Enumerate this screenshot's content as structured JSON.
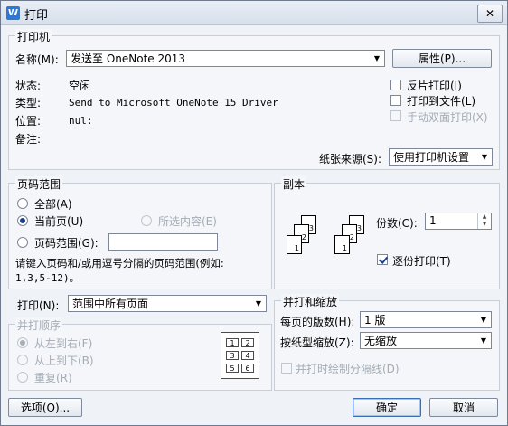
{
  "window": {
    "title": "打印",
    "app_icon": "W",
    "close_glyph": "✕"
  },
  "printer": {
    "group_label": "打印机",
    "name_label": "名称(M):",
    "name_value": "发送至 OneNote 2013",
    "properties_button": "属性(P)...",
    "status_label": "状态:",
    "status_value": "空闲",
    "type_label": "类型:",
    "type_value": "Send to Microsoft OneNote 15 Driver",
    "location_label": "位置:",
    "location_value": "nul:",
    "comment_label": "备注:",
    "reverse_print": "反片打印(I)",
    "print_to_file": "打印到文件(L)",
    "manual_duplex": "手动双面打印(X)",
    "paper_source_label": "纸张来源(S):",
    "paper_source_value": "使用打印机设置"
  },
  "page_range": {
    "group_label": "页码范围",
    "all": "全部(A)",
    "current": "当前页(U)",
    "selection": "所选内容(E)",
    "range": "页码范围(G):",
    "range_value": "",
    "hint_line1": "请键入页码和/或用逗号分隔的页码范围(例如:",
    "hint_line2": "1,3,5-12)。"
  },
  "copies": {
    "group_label": "副本",
    "count_label": "份数(C):",
    "count_value": "1",
    "collate": "逐份打印(T)",
    "page_numbers": [
      "1",
      "2",
      "3"
    ]
  },
  "print_what": {
    "label": "打印(N):",
    "value": "范围中所有页面"
  },
  "order": {
    "group_label": "并打顺序",
    "left_to_right": "从左到右(F)",
    "top_to_bottom": "从上到下(B)",
    "repeat": "重复(R)",
    "grid_numbers": [
      "1",
      "2",
      "3",
      "4",
      "5",
      "6"
    ]
  },
  "zoom": {
    "group_label": "并打和缩放",
    "pages_per_sheet_label": "每页的版数(H):",
    "pages_per_sheet_value": "1 版",
    "scale_label": "按纸型缩放(Z):",
    "scale_value": "无缩放",
    "draw_separator": "并打时绘制分隔线(D)"
  },
  "footer": {
    "options_button": "选项(O)...",
    "ok_button": "确定",
    "cancel_button": "取消"
  }
}
